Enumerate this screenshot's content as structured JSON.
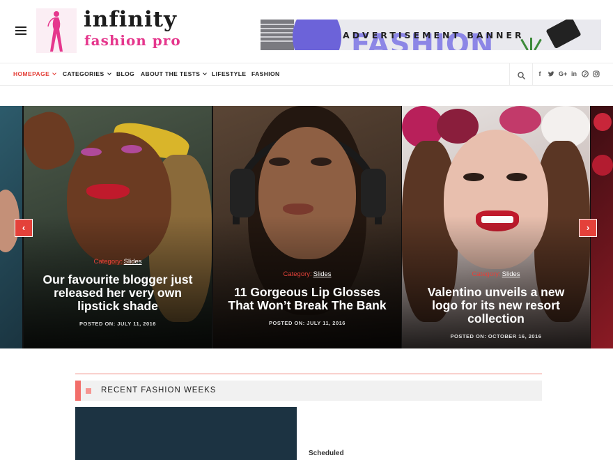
{
  "header": {
    "logo_line1": "infinity",
    "logo_line2": "fashion pro",
    "ad_text": "ADVERTISEMENT BANNER",
    "ad_bg_word": "FASHION"
  },
  "nav": {
    "items": [
      {
        "label": "HOMEPAGE",
        "dropdown": true,
        "active": true
      },
      {
        "label": "CATEGORIES",
        "dropdown": true,
        "active": false
      },
      {
        "label": "BLOG",
        "dropdown": false,
        "active": false
      },
      {
        "label": "ABOUT THE TESTS",
        "dropdown": true,
        "active": false
      },
      {
        "label": "LIFESTYLE",
        "dropdown": false,
        "active": false
      },
      {
        "label": "FASHION",
        "dropdown": false,
        "active": false
      }
    ],
    "icons": [
      "search-icon",
      "facebook-icon",
      "twitter-icon",
      "google-plus-icon",
      "linkedin-icon",
      "pinterest-icon",
      "instagram-icon"
    ]
  },
  "slider": {
    "slides": [
      {
        "category_label": "Category:",
        "category": "Slides",
        "title": "Our favourite blogger just released her very own lipstick shade",
        "posted": "POSTED ON: JULY 11, 2016"
      },
      {
        "category_label": "Category:",
        "category": "Slides",
        "title": "11 Gorgeous Lip Glosses That Won’t Break The Bank",
        "posted": "POSTED ON: JULY 11, 2016"
      },
      {
        "category_label": "Category:",
        "category": "Slides",
        "title": "Valentino unveils a new logo for its new resort collection",
        "posted": "POSTED ON: OCTOBER 16, 2016"
      }
    ],
    "prev_label": "‹",
    "next_label": "›"
  },
  "section": {
    "title": "RECENT FASHION WEEKS",
    "card_label": "Scheduled"
  },
  "colors": {
    "accent": "#e4413a",
    "brand_pink": "#e5378d",
    "section_accent": "#f26e6a"
  }
}
